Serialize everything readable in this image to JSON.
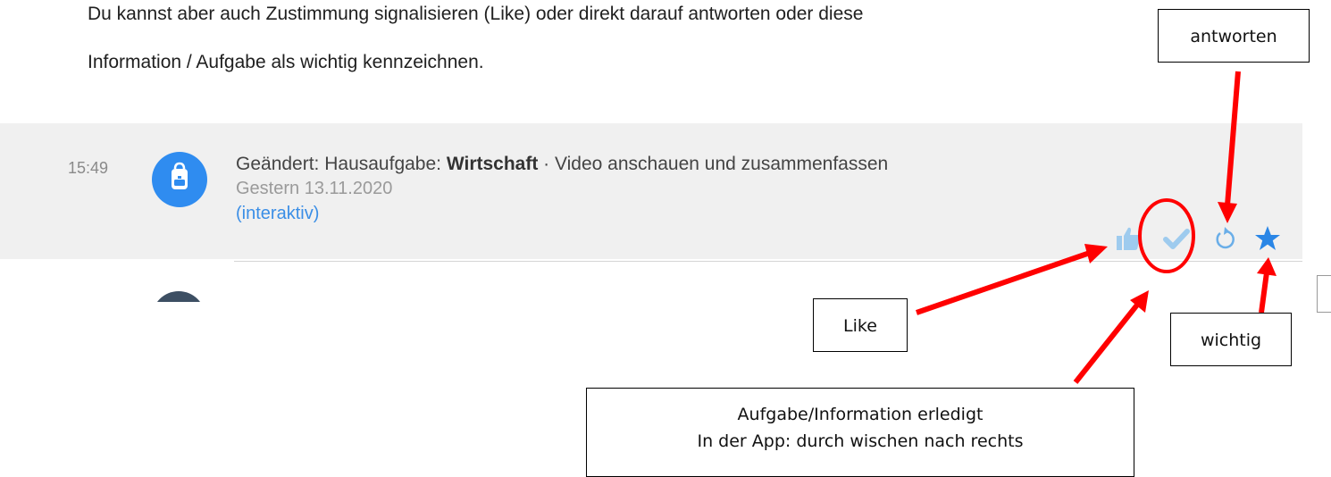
{
  "instructions": {
    "line1": "Du kannst aber auch Zustimmung signalisieren (Like) oder direkt darauf antworten oder diese",
    "line2": "Information / Aufgabe als wichtig kennzeichnen."
  },
  "feed_item": {
    "time": "15:49",
    "avatar_icon": "backpack-icon",
    "title_prefix": "Geändert: Hausaufgabe: ",
    "subject": "Wirtschaft",
    "separator": " · ",
    "title_suffix": "Video anschauen und zusammenfassen",
    "date": "Gestern 13.11.2020",
    "interactive_link": "(interaktiv)",
    "actions": [
      {
        "icon": "thumbs-up-icon",
        "color": "#9ecbee"
      },
      {
        "icon": "checkmark-icon",
        "color": "#9ecbee"
      },
      {
        "icon": "reply-icon",
        "color": "#6aaee8"
      },
      {
        "icon": "star-icon",
        "color": "#2a86e6"
      }
    ]
  },
  "callouts": {
    "antworten": "antworten",
    "like": "Like",
    "wichtig": "wichtig",
    "erledigt_line1": "Aufgabe/Information erledigt",
    "erledigt_line2": "In der App: durch wischen nach rechts"
  },
  "colors": {
    "annotation": "#ff0000",
    "accent": "#2f8cf0",
    "feed_background": "#f0f0f0"
  }
}
